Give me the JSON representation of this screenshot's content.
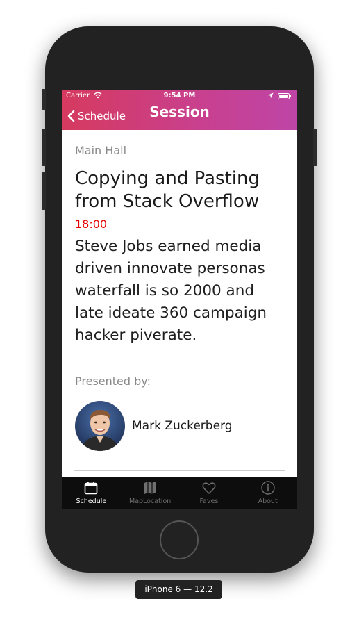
{
  "device_label": "iPhone 6 — 12.2",
  "status_bar": {
    "carrier": "Carrier",
    "time": "9:54 PM"
  },
  "nav": {
    "back_label": "Schedule",
    "title": "Session"
  },
  "session": {
    "room": "Main Hall",
    "title_line1": "Copying and Pasting",
    "title_line2": "from Stack Overflow",
    "time": "18:00",
    "description_lines": [
      "Steve Jobs earned media",
      "driven innovate personas",
      "waterfall is so 2000 and",
      "late ideate 360 campaign",
      "hacker piverate."
    ],
    "presented_by_label": "Presented by:",
    "speaker": {
      "name": "Mark Zuckerberg"
    }
  },
  "tabs": [
    {
      "label": "Schedule",
      "icon": "calendar-icon",
      "active": true
    },
    {
      "label": "MapLocation",
      "icon": "map-icon",
      "active": false
    },
    {
      "label": "Faves",
      "icon": "heart-icon",
      "active": false
    },
    {
      "label": "About",
      "icon": "info-icon",
      "active": false
    }
  ],
  "colors": {
    "header_gradient_start": "#d63a5f",
    "header_gradient_end": "#be45a6",
    "time_red": "#e40000",
    "tab_active": "#ffffff",
    "tab_inactive": "#6f6f6f"
  }
}
